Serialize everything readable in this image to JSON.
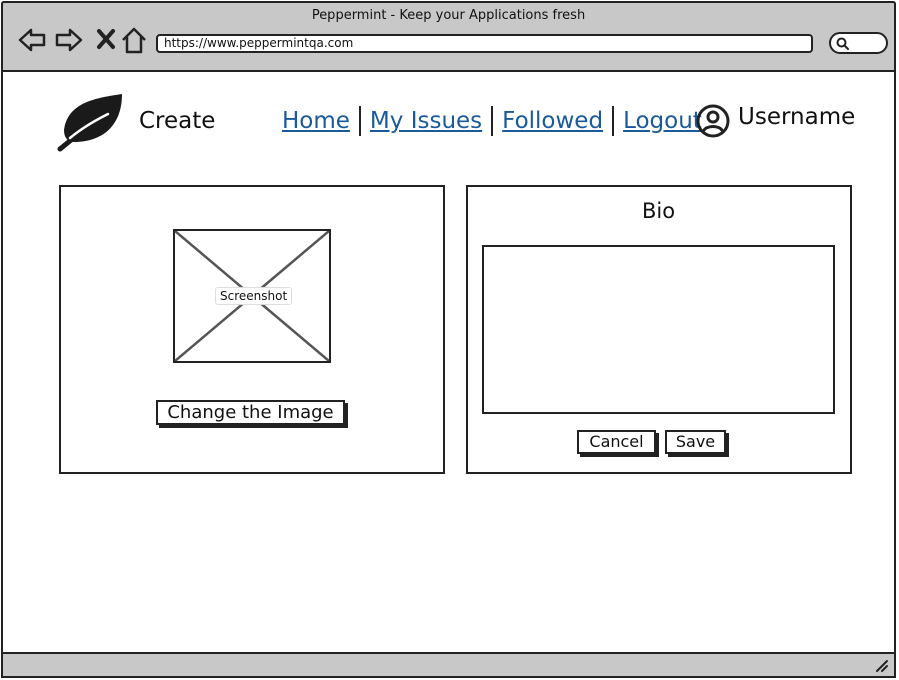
{
  "browser": {
    "window_title": "Peppermint - Keep your Applications fresh",
    "url": "https://www.peppermintqa.com"
  },
  "header": {
    "brand": "Create",
    "nav": [
      {
        "label": "Home"
      },
      {
        "label": "My Issues"
      },
      {
        "label": "Followed"
      },
      {
        "label": "Logout"
      }
    ],
    "username": "Username",
    "link_color": "#1a5a9a"
  },
  "image_panel": {
    "placeholder_label": "Screenshot",
    "change_button": "Change the Image"
  },
  "bio_panel": {
    "title": "Bio",
    "textarea_value": "",
    "cancel_button": "Cancel",
    "save_button": "Save"
  }
}
